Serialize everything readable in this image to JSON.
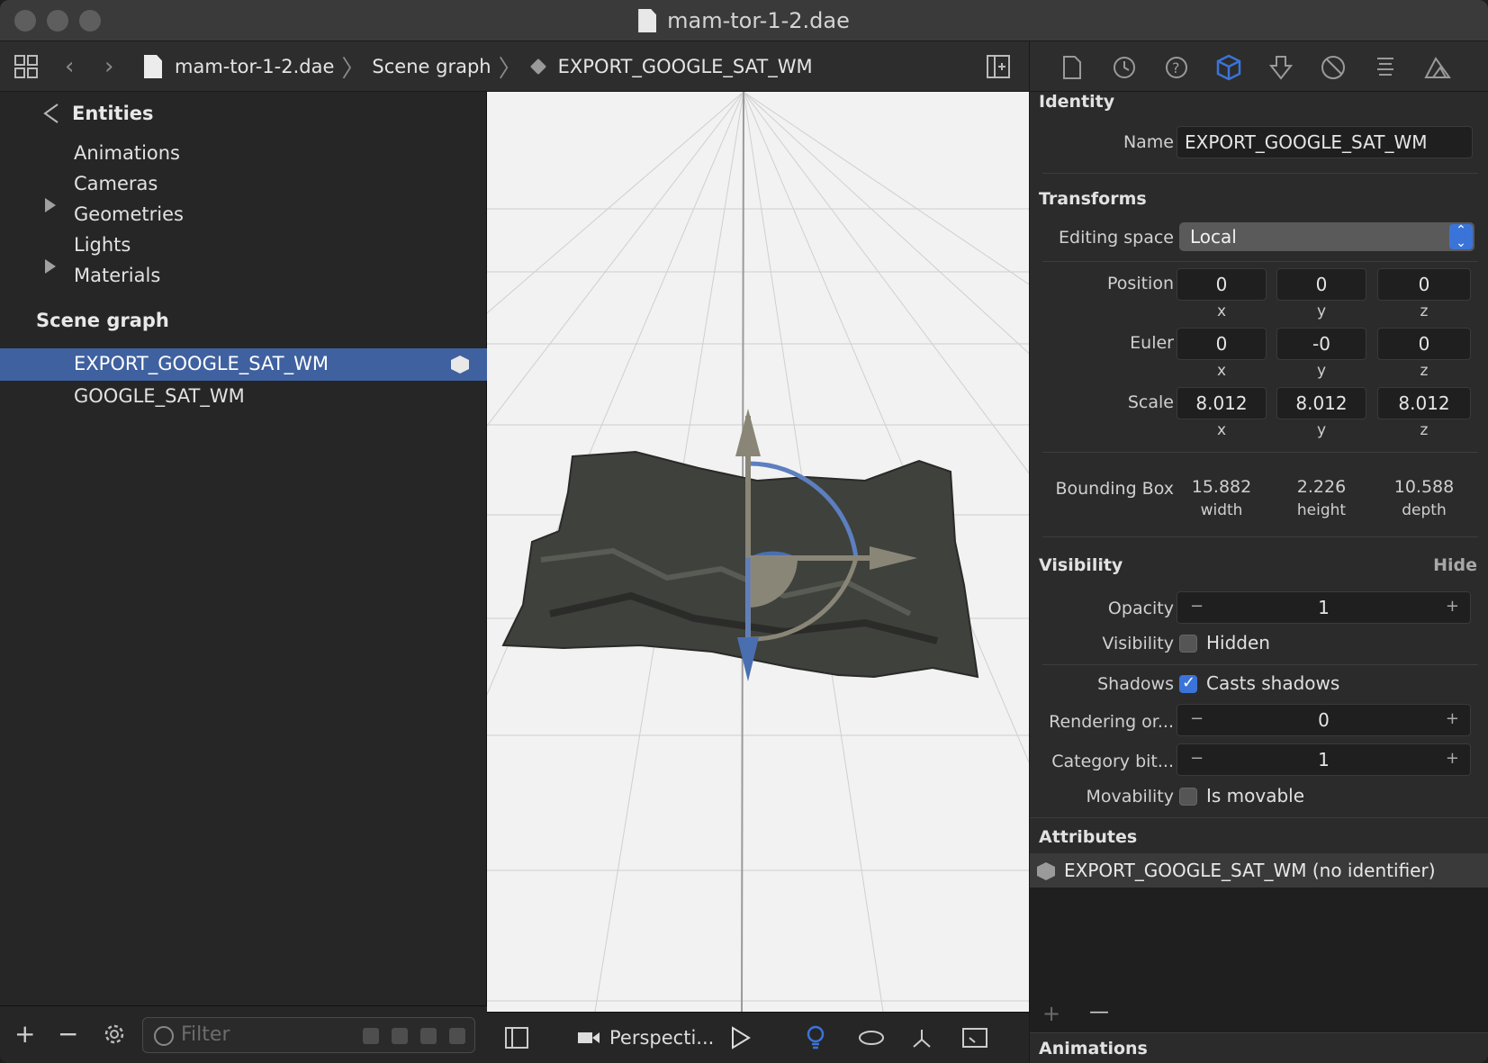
{
  "window": {
    "title": "mam-tor-1-2.dae"
  },
  "breadcrumb": {
    "file": "mam-tor-1-2.dae",
    "section": "Scene graph",
    "node": "EXPORT_GOOGLE_SAT_WM"
  },
  "sidebar": {
    "entities_label": "Entities",
    "entities": [
      {
        "label": "Animations",
        "expandable": false
      },
      {
        "label": "Cameras",
        "expandable": false
      },
      {
        "label": "Geometries",
        "expandable": true
      },
      {
        "label": "Lights",
        "expandable": false
      },
      {
        "label": "Materials",
        "expandable": true
      }
    ],
    "scene_graph_label": "Scene graph",
    "nodes": [
      {
        "label": "EXPORT_GOOGLE_SAT_WM",
        "selected": true
      },
      {
        "label": "GOOGLE_SAT_WM",
        "selected": false
      }
    ],
    "filter_placeholder": "Filter",
    "add_label": "+",
    "remove_label": "−"
  },
  "viewport": {
    "camera_label": "Perspecti..."
  },
  "inspector": {
    "identity": {
      "section": "Identity",
      "name_label": "Name",
      "name_value": "EXPORT_GOOGLE_SAT_WM"
    },
    "transforms": {
      "section": "Transforms",
      "editing_space_label": "Editing space",
      "editing_space_value": "Local",
      "position_label": "Position",
      "position": [
        "0",
        "0",
        "0"
      ],
      "euler_label": "Euler",
      "euler": [
        "0",
        "-0",
        "0"
      ],
      "scale_label": "Scale",
      "scale": [
        "8.012",
        "8.012",
        "8.012"
      ],
      "axes": [
        "x",
        "y",
        "z"
      ],
      "bbox_label": "Bounding Box",
      "bbox": [
        "15.882",
        "2.226",
        "10.588"
      ],
      "bbox_dims": [
        "width",
        "height",
        "depth"
      ]
    },
    "visibility": {
      "section": "Visibility",
      "hide_label": "Hide",
      "opacity_label": "Opacity",
      "opacity_value": "1",
      "visibility_label": "Visibility",
      "hidden_label": "Hidden",
      "shadows_label": "Shadows",
      "casts_shadows_label": "Casts shadows",
      "rendering_label": "Rendering or...",
      "rendering_value": "0",
      "category_label": "Category bit...",
      "category_value": "1",
      "movability_label": "Movability",
      "movable_label": "Is movable"
    },
    "attributes": {
      "section": "Attributes",
      "item": "EXPORT_GOOGLE_SAT_WM (no identifier)",
      "add_label": "+",
      "remove_label": "—"
    },
    "animations": {
      "section": "Animations"
    }
  }
}
